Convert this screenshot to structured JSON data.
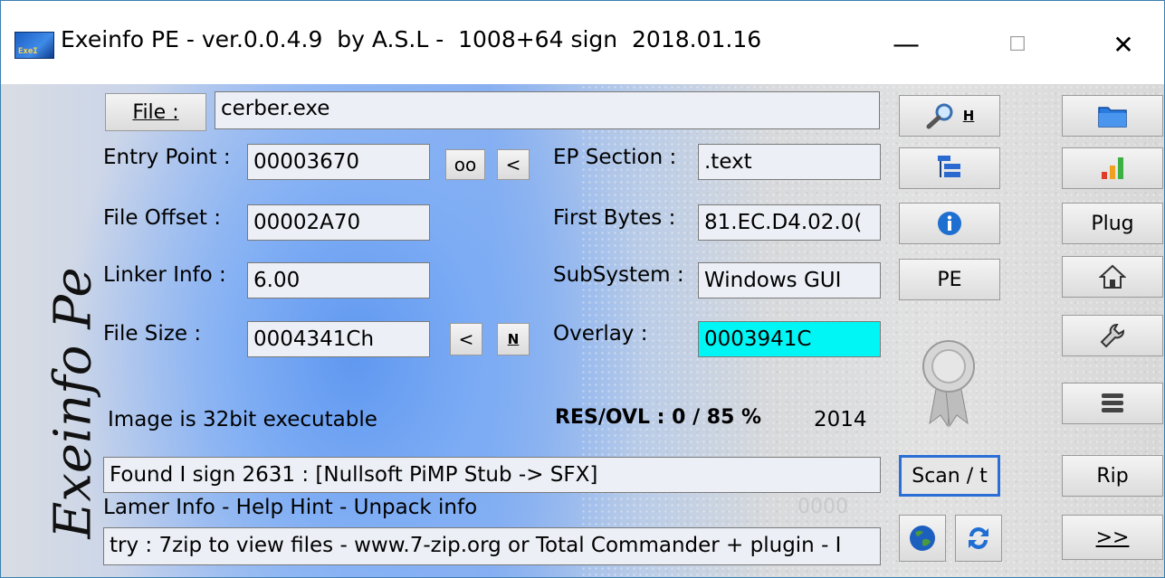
{
  "window": {
    "title": "Exeinfo PE - ver.0.0.4.9  by A.S.L -  1008+64 sign  2018.01.16",
    "icon_text": "ExeI",
    "minimize": "—",
    "maximize": "☐",
    "close": "✕"
  },
  "logo": "Exeinfo Pe",
  "file": {
    "button_label": "File :",
    "value": "cerber.exe"
  },
  "fields": {
    "entry_point": {
      "label": "Entry Point :",
      "value": "00003670"
    },
    "oo_button": "oo",
    "ep_prev_button": "<",
    "ep_section": {
      "label": "EP Section :",
      "value": ".text"
    },
    "file_offset": {
      "label": "File Offset :",
      "value": "00002A70"
    },
    "first_bytes": {
      "label": "First Bytes :",
      "value": "81.EC.D4.02.0("
    },
    "linker_info": {
      "label": "Linker Info :",
      "value": "6.00"
    },
    "subsystem": {
      "label": "SubSystem :",
      "value": "Windows GUI"
    },
    "file_size": {
      "label": "File Size :",
      "value": "0004341Ch"
    },
    "size_prev_button": "<",
    "n_button": "N",
    "overlay": {
      "label": "Overlay :",
      "value": "0003941C"
    }
  },
  "status": {
    "image_type": "Image is 32bit executable",
    "res_ovl": "RES/OVL : 0 / 85 %",
    "year": "2014",
    "found": "Found I  sign 2631 : [Nullsoft PiMP Stub -> SFX]",
    "lamer_info": "Lamer Info - Help Hint - Unpack info",
    "counter": "0000",
    "hint": "try : 7zip to view files - www.7-zip.org or Total Commander + plugin - I"
  },
  "middle_buttons": {
    "h_label": "H",
    "pe_label": "PE",
    "scan_label": "Scan / t"
  },
  "right_buttons": {
    "plug_label": "Plug",
    "rip_label": "Rip",
    "more_label": ">>"
  },
  "colors": {
    "overlay_highlight": "#00f5f5",
    "accent_blue": "#1e6fd0"
  }
}
